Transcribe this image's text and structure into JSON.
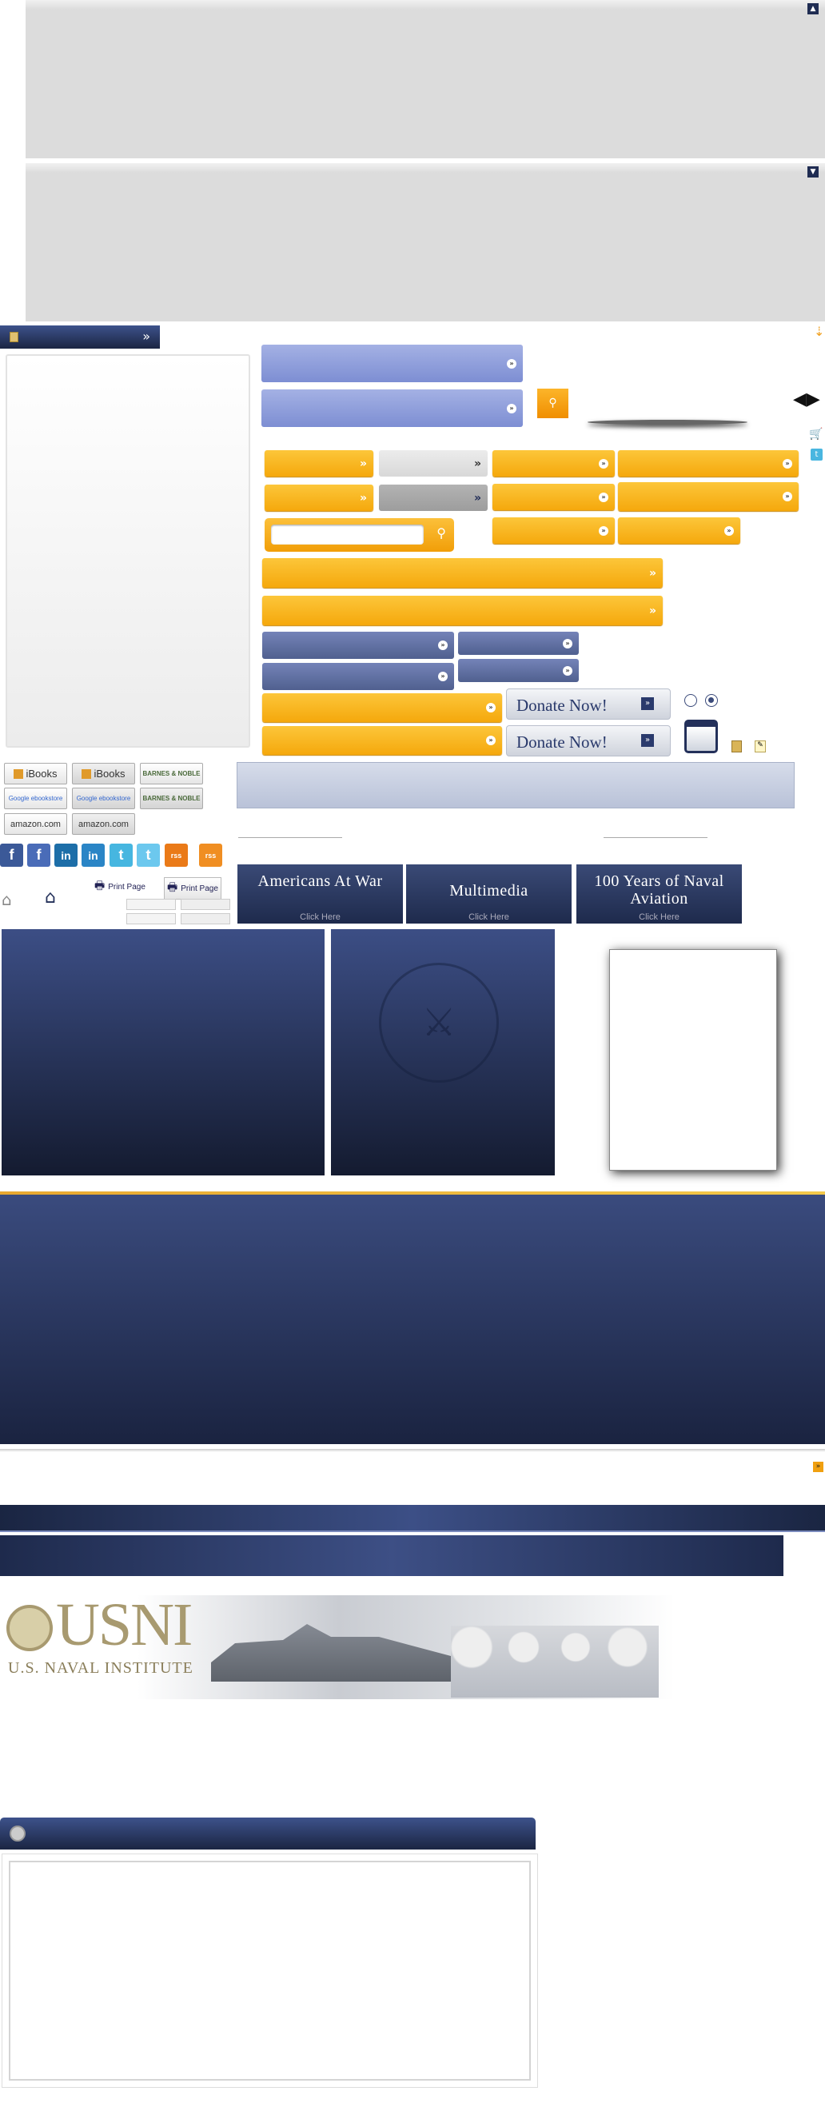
{
  "top_panels": {
    "collapse_icon": "chevron-up",
    "expand_icon": "chevron-down"
  },
  "sidebar_header": {
    "arrow": "»"
  },
  "arrows": {
    "double": "»"
  },
  "search_button": {
    "icon": "search-icon"
  },
  "donate": {
    "label": "Donate Now!"
  },
  "store_buttons": [
    {
      "label": "iBooks"
    },
    {
      "label": "iBooks"
    },
    {
      "label": "BARNES & NOBLE"
    },
    {
      "label": "Google ebookstore"
    },
    {
      "label": "Google ebookstore"
    },
    {
      "label": "BARNES & NOBLE"
    },
    {
      "label": "amazon.com"
    },
    {
      "label": "amazon.com"
    }
  ],
  "social": {
    "facebook": "f",
    "linkedin": "in",
    "twitter": "t",
    "rss": "rss"
  },
  "print": {
    "label": "Print Page"
  },
  "banners": [
    {
      "title": "Americans At War",
      "cta": "Click Here"
    },
    {
      "title": "Multimedia",
      "cta": "Click Here"
    },
    {
      "title": "100 Years of Naval Aviation",
      "cta": "Click Here"
    }
  ],
  "logo": {
    "name": "USNI",
    "subtitle": "U.S. NAVAL INSTITUTE"
  },
  "seal": {
    "text": "U.S. NAVAL INSTITUTE"
  },
  "colors": {
    "orange": "#f7ad14",
    "navy": "#25335c",
    "light_blue": "#93a2de",
    "slate": "#5b6a9c"
  }
}
